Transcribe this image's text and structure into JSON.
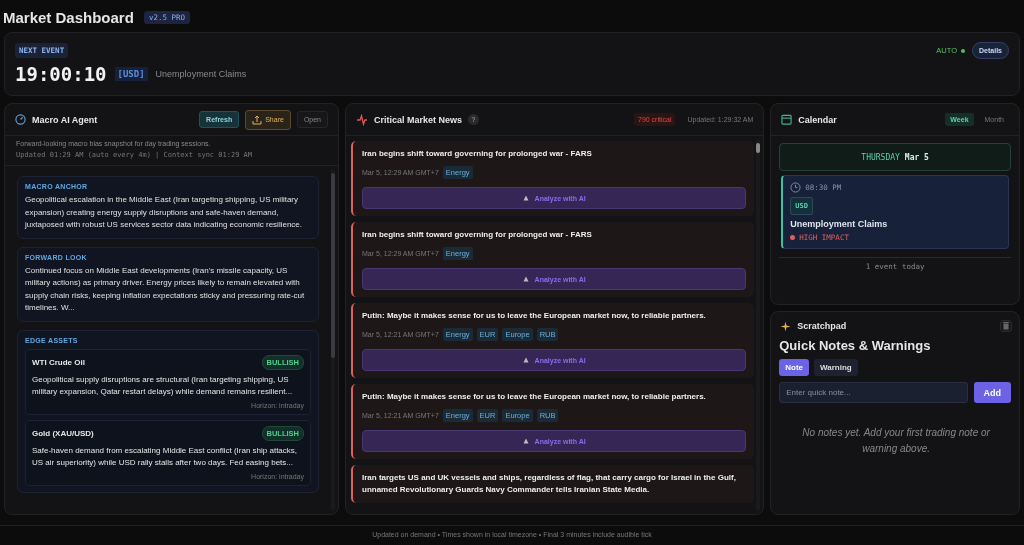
{
  "header": {
    "title": "Market Dashboard",
    "version": "v2.5 PRO"
  },
  "next_event": {
    "label": "NEXT EVENT",
    "countdown": "19:00:10",
    "currency": "[USD]",
    "name": "Unemployment Claims",
    "auto_label": "AUTO",
    "auto_on": true,
    "details_button": "Details"
  },
  "agent": {
    "title": "Macro AI Agent",
    "buttons": [
      "Refresh",
      "Share",
      "Open"
    ],
    "subtitle": "Forward-looking macro bias snapshot for day trading sessions.",
    "meta": "Updated 01:29 AM (auto every 4m) | Context sync 01:29 AM",
    "sections": [
      {
        "heading": "MACRO ANCHOR",
        "text": "Geopolitical escalation in the Middle East (Iran targeting shipping, US military expansion) creating energy supply disruptions and safe-haven demand, juxtaposed with robust US services sector data indicating economic resilience."
      },
      {
        "heading": "FORWARD LOOK",
        "text": "Continued focus on Middle East developments (Iran's missile capacity, US military actions) as primary driver. Energy prices likely to remain elevated with supply chain risks, keeping inflation expectations sticky and pressuring rate-cut timelines. W..."
      }
    ],
    "assets_heading": "EDGE ASSETS",
    "assets": [
      {
        "name": "WTI Crude Oil",
        "bias": "BULLISH",
        "text": "Geopolitical supply disruptions are structural (Iran targeting shipping, US military expansion, Qatar restart delays) while demand remains resilient...",
        "horizon": "Horizon: intraday"
      },
      {
        "name": "Gold (XAU/USD)",
        "bias": "BULLISH",
        "text": "Safe-haven demand from escalating Middle East conflict (Iran ship attacks, US air superiority) while USD rally stalls after two days. Fed easing bets...",
        "horizon": "Horizon: intraday"
      }
    ]
  },
  "news": {
    "title": "Critical Market News",
    "help": "?",
    "critical_count": "790 critical",
    "updated": "Updated: 1:29:32 AM",
    "items": [
      {
        "headline": "Iran begins shift toward governing for prolonged war - FARS",
        "time": "Mar 5, 12:29 AM GMT+7",
        "tags": [
          "Energy"
        ],
        "analyze_label": "Analyze with AI"
      },
      {
        "headline": "Iran begins shift toward governing for prolonged war - FARS",
        "time": "Mar 5, 12:29 AM GMT+7",
        "tags": [
          "Energy"
        ],
        "analyze_label": "Analyze with AI"
      },
      {
        "headline": "Putin: Maybe it makes sense for us to leave the European market now, to reliable partners.",
        "time": "Mar 5, 12:21 AM GMT+7",
        "tags": [
          "Energy",
          "EUR",
          "Europe",
          "RUB"
        ],
        "analyze_label": "Analyze with AI"
      },
      {
        "headline": "Putin: Maybe it makes sense for us to leave the European market now, to reliable partners.",
        "time": "Mar 5, 12:21 AM GMT+7",
        "tags": [
          "Energy",
          "EUR",
          "Europe",
          "RUB"
        ],
        "analyze_label": "Analyze with AI"
      },
      {
        "headline": "Iran targets US and UK vessels and ships, regardless of flag, that carry cargo for Israel in the Gulf, unnamed Revolutionary Guards Navy Commander tells Iranian State Media."
      }
    ]
  },
  "calendar": {
    "title": "Calendar",
    "tabs": [
      {
        "label": "Week",
        "selected": true
      },
      {
        "label": "Month",
        "selected": false
      }
    ],
    "day": "THURSDAY",
    "date": "Mar 5",
    "events": [
      {
        "time": "08:30 PM",
        "currency": "USD",
        "name": "Unemployment Claims",
        "impact": "HIGH IMPACT"
      }
    ],
    "footer": "1 event today"
  },
  "scratchpad": {
    "label": "Scratchpad",
    "title": "Quick Notes & Warnings",
    "types": [
      {
        "label": "Note",
        "selected": true
      },
      {
        "label": "Warning",
        "selected": false
      }
    ],
    "placeholder": "Enter quick note...",
    "add_button": "Add",
    "empty": "No notes yet. Add your first trading note or warning above."
  },
  "footer": "Updated on demand • Times shown in local timezone • Final 3 minutes include audible tick"
}
